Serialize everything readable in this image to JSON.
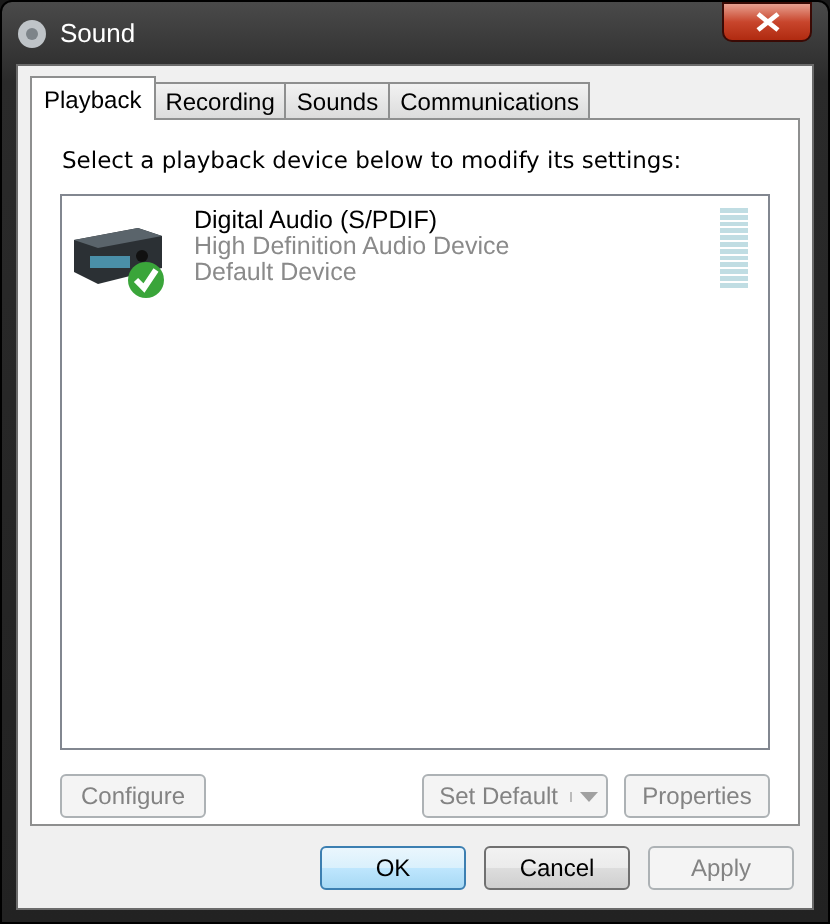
{
  "window": {
    "title": "Sound"
  },
  "tabs": [
    {
      "label": "Playback",
      "selected": true
    },
    {
      "label": "Recording",
      "selected": false
    },
    {
      "label": "Sounds",
      "selected": false
    },
    {
      "label": "Communications",
      "selected": false
    }
  ],
  "instruction": "Select a playback device below to modify its settings:",
  "devices": [
    {
      "name": "Digital Audio (S/PDIF)",
      "description": "High Definition Audio Device",
      "status": "Default Device",
      "is_default": true,
      "level": 0
    }
  ],
  "panel_buttons": [
    {
      "label": "Configure",
      "disabled": true,
      "kind": "plain"
    },
    {
      "label": "Set Default",
      "disabled": true,
      "kind": "split"
    },
    {
      "label": "Properties",
      "disabled": true,
      "kind": "plain"
    }
  ],
  "dialog_buttons": [
    {
      "label": "OK",
      "disabled": false,
      "default": true
    },
    {
      "label": "Cancel",
      "disabled": false,
      "default": false
    },
    {
      "label": "Apply",
      "disabled": true,
      "default": false
    }
  ]
}
